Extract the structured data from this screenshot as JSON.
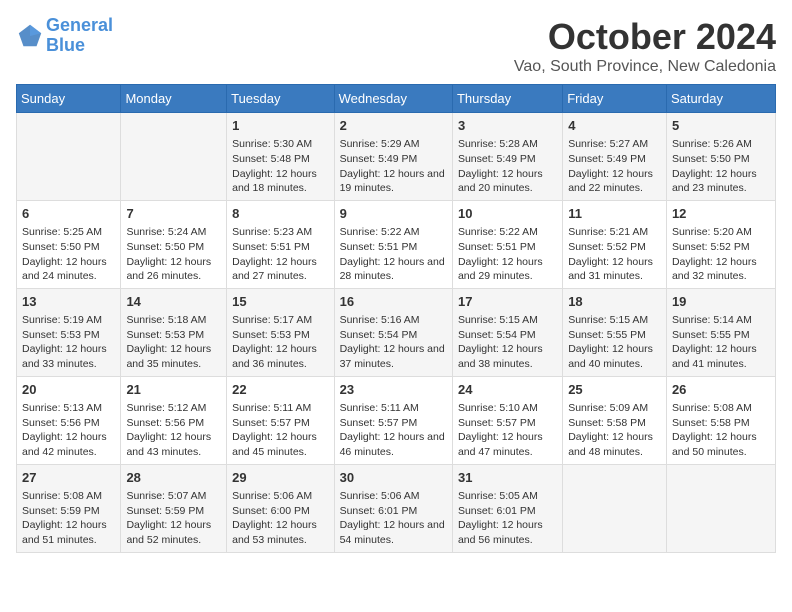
{
  "logo": {
    "line1": "General",
    "line2": "Blue"
  },
  "title": "October 2024",
  "location": "Vao, South Province, New Caledonia",
  "days_of_week": [
    "Sunday",
    "Monday",
    "Tuesday",
    "Wednesday",
    "Thursday",
    "Friday",
    "Saturday"
  ],
  "weeks": [
    [
      {
        "day": "",
        "sunrise": "",
        "sunset": "",
        "daylight": ""
      },
      {
        "day": "",
        "sunrise": "",
        "sunset": "",
        "daylight": ""
      },
      {
        "day": "1",
        "sunrise": "Sunrise: 5:30 AM",
        "sunset": "Sunset: 5:48 PM",
        "daylight": "Daylight: 12 hours and 18 minutes."
      },
      {
        "day": "2",
        "sunrise": "Sunrise: 5:29 AM",
        "sunset": "Sunset: 5:49 PM",
        "daylight": "Daylight: 12 hours and 19 minutes."
      },
      {
        "day": "3",
        "sunrise": "Sunrise: 5:28 AM",
        "sunset": "Sunset: 5:49 PM",
        "daylight": "Daylight: 12 hours and 20 minutes."
      },
      {
        "day": "4",
        "sunrise": "Sunrise: 5:27 AM",
        "sunset": "Sunset: 5:49 PM",
        "daylight": "Daylight: 12 hours and 22 minutes."
      },
      {
        "day": "5",
        "sunrise": "Sunrise: 5:26 AM",
        "sunset": "Sunset: 5:50 PM",
        "daylight": "Daylight: 12 hours and 23 minutes."
      }
    ],
    [
      {
        "day": "6",
        "sunrise": "Sunrise: 5:25 AM",
        "sunset": "Sunset: 5:50 PM",
        "daylight": "Daylight: 12 hours and 24 minutes."
      },
      {
        "day": "7",
        "sunrise": "Sunrise: 5:24 AM",
        "sunset": "Sunset: 5:50 PM",
        "daylight": "Daylight: 12 hours and 26 minutes."
      },
      {
        "day": "8",
        "sunrise": "Sunrise: 5:23 AM",
        "sunset": "Sunset: 5:51 PM",
        "daylight": "Daylight: 12 hours and 27 minutes."
      },
      {
        "day": "9",
        "sunrise": "Sunrise: 5:22 AM",
        "sunset": "Sunset: 5:51 PM",
        "daylight": "Daylight: 12 hours and 28 minutes."
      },
      {
        "day": "10",
        "sunrise": "Sunrise: 5:22 AM",
        "sunset": "Sunset: 5:51 PM",
        "daylight": "Daylight: 12 hours and 29 minutes."
      },
      {
        "day": "11",
        "sunrise": "Sunrise: 5:21 AM",
        "sunset": "Sunset: 5:52 PM",
        "daylight": "Daylight: 12 hours and 31 minutes."
      },
      {
        "day": "12",
        "sunrise": "Sunrise: 5:20 AM",
        "sunset": "Sunset: 5:52 PM",
        "daylight": "Daylight: 12 hours and 32 minutes."
      }
    ],
    [
      {
        "day": "13",
        "sunrise": "Sunrise: 5:19 AM",
        "sunset": "Sunset: 5:53 PM",
        "daylight": "Daylight: 12 hours and 33 minutes."
      },
      {
        "day": "14",
        "sunrise": "Sunrise: 5:18 AM",
        "sunset": "Sunset: 5:53 PM",
        "daylight": "Daylight: 12 hours and 35 minutes."
      },
      {
        "day": "15",
        "sunrise": "Sunrise: 5:17 AM",
        "sunset": "Sunset: 5:53 PM",
        "daylight": "Daylight: 12 hours and 36 minutes."
      },
      {
        "day": "16",
        "sunrise": "Sunrise: 5:16 AM",
        "sunset": "Sunset: 5:54 PM",
        "daylight": "Daylight: 12 hours and 37 minutes."
      },
      {
        "day": "17",
        "sunrise": "Sunrise: 5:15 AM",
        "sunset": "Sunset: 5:54 PM",
        "daylight": "Daylight: 12 hours and 38 minutes."
      },
      {
        "day": "18",
        "sunrise": "Sunrise: 5:15 AM",
        "sunset": "Sunset: 5:55 PM",
        "daylight": "Daylight: 12 hours and 40 minutes."
      },
      {
        "day": "19",
        "sunrise": "Sunrise: 5:14 AM",
        "sunset": "Sunset: 5:55 PM",
        "daylight": "Daylight: 12 hours and 41 minutes."
      }
    ],
    [
      {
        "day": "20",
        "sunrise": "Sunrise: 5:13 AM",
        "sunset": "Sunset: 5:56 PM",
        "daylight": "Daylight: 12 hours and 42 minutes."
      },
      {
        "day": "21",
        "sunrise": "Sunrise: 5:12 AM",
        "sunset": "Sunset: 5:56 PM",
        "daylight": "Daylight: 12 hours and 43 minutes."
      },
      {
        "day": "22",
        "sunrise": "Sunrise: 5:11 AM",
        "sunset": "Sunset: 5:57 PM",
        "daylight": "Daylight: 12 hours and 45 minutes."
      },
      {
        "day": "23",
        "sunrise": "Sunrise: 5:11 AM",
        "sunset": "Sunset: 5:57 PM",
        "daylight": "Daylight: 12 hours and 46 minutes."
      },
      {
        "day": "24",
        "sunrise": "Sunrise: 5:10 AM",
        "sunset": "Sunset: 5:57 PM",
        "daylight": "Daylight: 12 hours and 47 minutes."
      },
      {
        "day": "25",
        "sunrise": "Sunrise: 5:09 AM",
        "sunset": "Sunset: 5:58 PM",
        "daylight": "Daylight: 12 hours and 48 minutes."
      },
      {
        "day": "26",
        "sunrise": "Sunrise: 5:08 AM",
        "sunset": "Sunset: 5:58 PM",
        "daylight": "Daylight: 12 hours and 50 minutes."
      }
    ],
    [
      {
        "day": "27",
        "sunrise": "Sunrise: 5:08 AM",
        "sunset": "Sunset: 5:59 PM",
        "daylight": "Daylight: 12 hours and 51 minutes."
      },
      {
        "day": "28",
        "sunrise": "Sunrise: 5:07 AM",
        "sunset": "Sunset: 5:59 PM",
        "daylight": "Daylight: 12 hours and 52 minutes."
      },
      {
        "day": "29",
        "sunrise": "Sunrise: 5:06 AM",
        "sunset": "Sunset: 6:00 PM",
        "daylight": "Daylight: 12 hours and 53 minutes."
      },
      {
        "day": "30",
        "sunrise": "Sunrise: 5:06 AM",
        "sunset": "Sunset: 6:01 PM",
        "daylight": "Daylight: 12 hours and 54 minutes."
      },
      {
        "day": "31",
        "sunrise": "Sunrise: 5:05 AM",
        "sunset": "Sunset: 6:01 PM",
        "daylight": "Daylight: 12 hours and 56 minutes."
      },
      {
        "day": "",
        "sunrise": "",
        "sunset": "",
        "daylight": ""
      },
      {
        "day": "",
        "sunrise": "",
        "sunset": "",
        "daylight": ""
      }
    ]
  ]
}
